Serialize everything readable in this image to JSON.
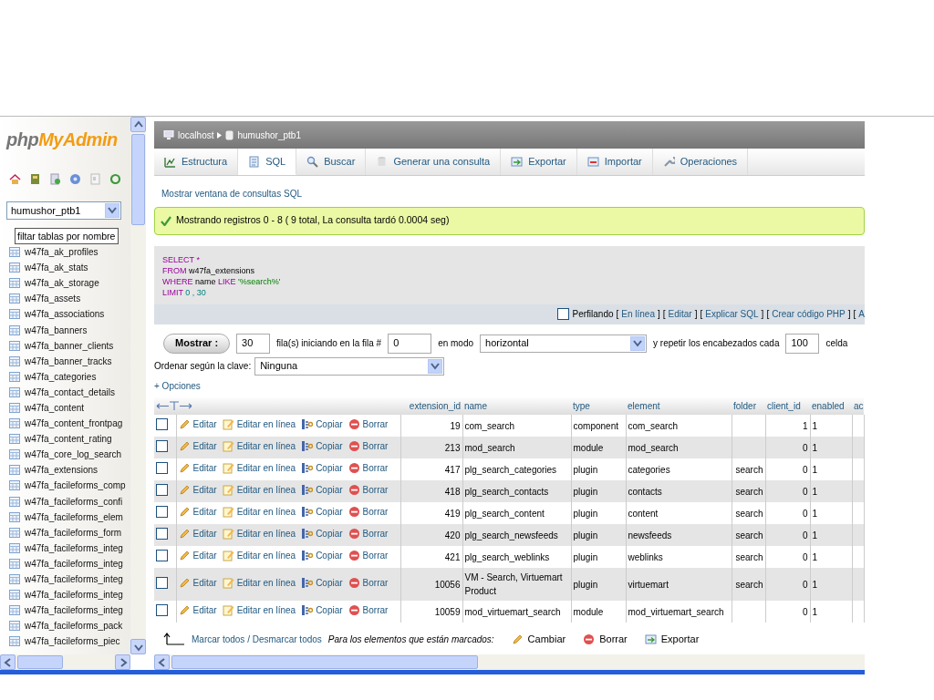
{
  "sidebar": {
    "logo_prefix": "php",
    "logo_suffix": "MyAdmin",
    "database": "humushor_ptb1",
    "filter": {
      "value": "filtar tablas por nombre"
    },
    "tables": [
      "w47fa_ak_profiles",
      "w47fa_ak_stats",
      "w47fa_ak_storage",
      "w47fa_assets",
      "w47fa_associations",
      "w47fa_banners",
      "w47fa_banner_clients",
      "w47fa_banner_tracks",
      "w47fa_categories",
      "w47fa_contact_details",
      "w47fa_content",
      "w47fa_content_frontpag",
      "w47fa_content_rating",
      "w47fa_core_log_search",
      "w47fa_extensions",
      "w47fa_facileforms_comp",
      "w47fa_facileforms_confi",
      "w47fa_facileforms_elem",
      "w47fa_facileforms_form",
      "w47fa_facileforms_integ",
      "w47fa_facileforms_integ",
      "w47fa_facileforms_integ",
      "w47fa_facileforms_integ",
      "w47fa_facileforms_integ",
      "w47fa_facileforms_pack",
      "w47fa_facileforms_piec"
    ]
  },
  "breadcrumb": [
    "localhost",
    "humushor_ptb1"
  ],
  "tabs": [
    {
      "label": "Estructura",
      "selected": false
    },
    {
      "label": "SQL",
      "selected": true
    },
    {
      "label": "Buscar",
      "selected": false
    },
    {
      "label": "Generar una consulta",
      "selected": false
    },
    {
      "label": "Exportar",
      "selected": false
    },
    {
      "label": "Importar",
      "selected": false
    },
    {
      "label": "Operaciones",
      "selected": false
    }
  ],
  "query_window_link": "Mostrar ventana de consultas SQL",
  "message": "Mostrando registros 0 - 8 ( 9 total, La consulta tardó 0.0004 seg)",
  "sql_query": [
    [
      {
        "kind": "keyword",
        "text": "SELECT"
      },
      {
        "kind": "keyword",
        "text": "*"
      }
    ],
    [
      {
        "kind": "keyword",
        "text": "FROM"
      },
      {
        "kind": "plain",
        "text": "w47fa_extensions"
      }
    ],
    [
      {
        "kind": "keyword",
        "text": "WHERE"
      },
      {
        "kind": "plain",
        "text": "name"
      },
      {
        "kind": "keyword",
        "text": "LIKE"
      },
      {
        "kind": "string",
        "text": "'%search%'"
      }
    ],
    [
      {
        "kind": "keyword",
        "text": "LIMIT"
      },
      {
        "kind": "number",
        "text": "0 , 30"
      }
    ]
  ],
  "profiling": {
    "label": "Perfilando",
    "checked": false,
    "links": [
      {
        "open": "[",
        "label": "En línea",
        "close": "]"
      },
      {
        "open": "[",
        "label": "Editar",
        "close": "]"
      },
      {
        "open": "[",
        "label": "Explicar SQL",
        "close": "]"
      },
      {
        "open": "[",
        "label": "Crear código PHP",
        "close": "]"
      },
      {
        "open": "[",
        "label": "A"
      }
    ]
  },
  "navigation": {
    "button": "Mostrar :",
    "rows": "30",
    "rows_label": "fila(s) iniciando en la fila #",
    "start": "0",
    "mode_label": "en modo",
    "mode": "horizontal",
    "repeat_label": "y repetir los encabezados cada",
    "repeat": "100",
    "cells_label": "celda"
  },
  "sort": {
    "label": "Ordenar según la clave:",
    "value": "Ninguna"
  },
  "options_link": "+ Opciones",
  "table": {
    "columns": [
      "extension_id",
      "name",
      "type",
      "element",
      "folder",
      "client_id",
      "enabled",
      "ac"
    ],
    "rows": [
      {
        "checked": false,
        "actions": [
          "Editar",
          "Editar en línea",
          "Copiar",
          "Borrar"
        ],
        "cells": [
          "19",
          "com_search",
          "component",
          "com_search",
          "",
          "1",
          "1"
        ]
      },
      {
        "checked": false,
        "actions": [
          "Editar",
          "Editar en línea",
          "Copiar",
          "Borrar"
        ],
        "cells": [
          "213",
          "mod_search",
          "module",
          "mod_search",
          "",
          "0",
          "1"
        ]
      },
      {
        "checked": false,
        "actions": [
          "Editar",
          "Editar en línea",
          "Copiar",
          "Borrar"
        ],
        "cells": [
          "417",
          "plg_search_categories",
          "plugin",
          "categories",
          "search",
          "0",
          "1"
        ]
      },
      {
        "checked": false,
        "actions": [
          "Editar",
          "Editar en línea",
          "Copiar",
          "Borrar"
        ],
        "cells": [
          "418",
          "plg_search_contacts",
          "plugin",
          "contacts",
          "search",
          "0",
          "1"
        ]
      },
      {
        "checked": false,
        "actions": [
          "Editar",
          "Editar en línea",
          "Copiar",
          "Borrar"
        ],
        "cells": [
          "419",
          "plg_search_content",
          "plugin",
          "content",
          "search",
          "0",
          "1"
        ]
      },
      {
        "checked": false,
        "actions": [
          "Editar",
          "Editar en línea",
          "Copiar",
          "Borrar"
        ],
        "cells": [
          "420",
          "plg_search_newsfeeds",
          "plugin",
          "newsfeeds",
          "search",
          "0",
          "1"
        ]
      },
      {
        "checked": false,
        "actions": [
          "Editar",
          "Editar en línea",
          "Copiar",
          "Borrar"
        ],
        "cells": [
          "421",
          "plg_search_weblinks",
          "plugin",
          "weblinks",
          "search",
          "0",
          "1"
        ]
      },
      {
        "checked": false,
        "actions": [
          "Editar",
          "Editar en línea",
          "Copiar",
          "Borrar"
        ],
        "cells": [
          "10056",
          "VM - Search, Virtuemart Product",
          "plugin",
          "virtuemart",
          "search",
          "0",
          "1"
        ]
      },
      {
        "checked": false,
        "actions": [
          "Editar",
          "Editar en línea",
          "Copiar",
          "Borrar"
        ],
        "cells": [
          "10059",
          "mod_virtuemart_search",
          "module",
          "mod_virtuemart_search",
          "",
          "0",
          "1"
        ]
      }
    ]
  },
  "footer": {
    "check_all": "Marcar todos / Desmarcar todos",
    "with_selected": "Para los elementos que están marcados:",
    "actions": [
      {
        "kind": "edit",
        "label": "Cambiar"
      },
      {
        "kind": "delete",
        "label": "Borrar"
      },
      {
        "kind": "export",
        "label": "Exportar"
      }
    ]
  }
}
